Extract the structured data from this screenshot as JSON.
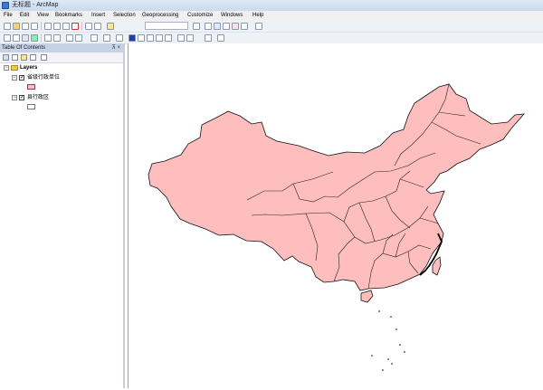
{
  "window": {
    "title": "无标题 - ArcMap"
  },
  "menu": {
    "items": [
      "File",
      "Edit",
      "View",
      "Bookmarks",
      "Insert",
      "Selection",
      "Geoprocessing",
      "Customize",
      "Windows",
      "Help"
    ]
  },
  "toc": {
    "title": "Table Of Contents",
    "header_icons": "⊼ ×",
    "layers_label": "Layers",
    "layers": [
      {
        "name": "省级行政单位",
        "checked": "✓",
        "fill_color": "#f7c0c3"
      },
      {
        "name": "县行政区",
        "checked": "✓",
        "fill_color": "#ffffff"
      }
    ]
  },
  "map": {
    "fill_color": "#ffbebe",
    "outline_color": "#111111",
    "background": "#ffffff"
  },
  "colors": {
    "titlebar": "#c9dbf1",
    "toc_header": "#c6d3e6"
  }
}
